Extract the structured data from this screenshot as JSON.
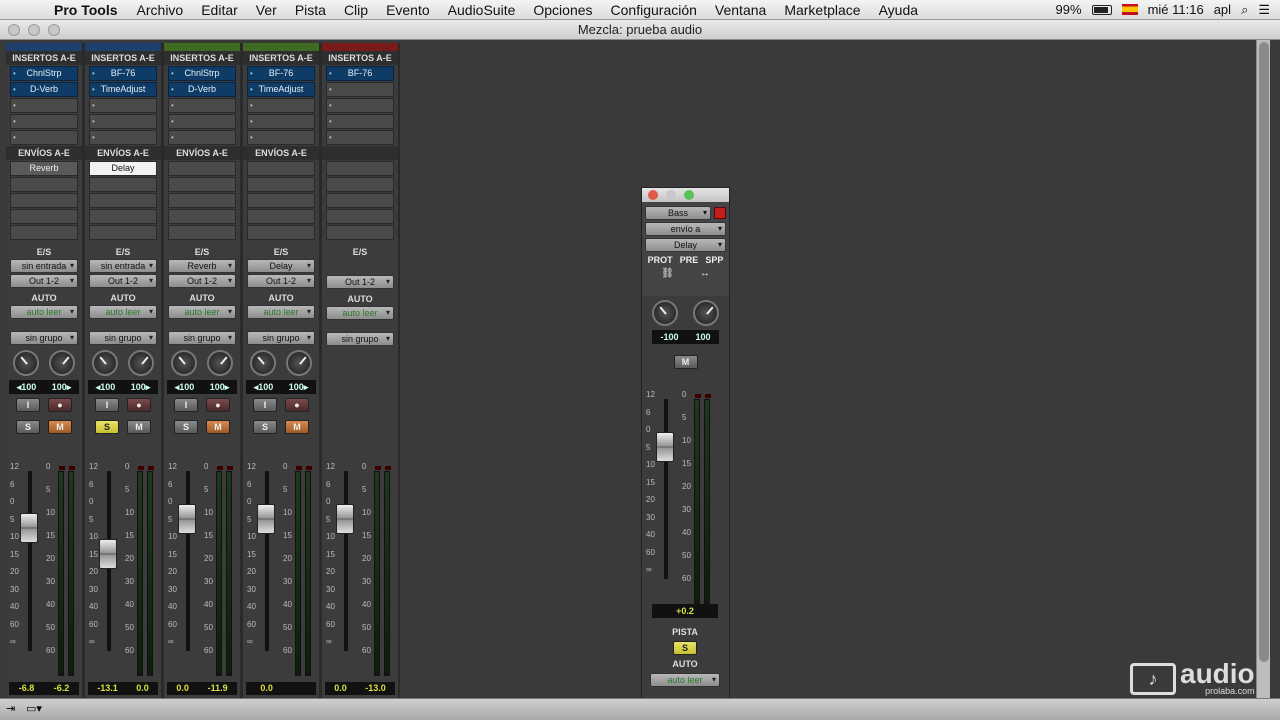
{
  "menubar": {
    "app": "Pro Tools",
    "items": [
      "Archivo",
      "Editar",
      "Ver",
      "Pista",
      "Clip",
      "Evento",
      "AudioSuite",
      "Opciones",
      "Configuración",
      "Ventana",
      "Marketplace",
      "Ayuda"
    ],
    "battery": "99%",
    "clock": "mié 11:16",
    "user": "apl"
  },
  "window": {
    "title": "Mezcla: prueba audio"
  },
  "strips": [
    {
      "color": "#1f3f6e",
      "inserts_label": "INSERTOS A-E",
      "inserts": [
        "ChnlStrp",
        "D-Verb"
      ],
      "sends_label": "ENVÍOS A-E",
      "send": "Reverb",
      "send_on": false,
      "io_label": "E/S",
      "input": "sin entrada",
      "output": "Out 1-2",
      "auto_label": "AUTO",
      "auto": "auto leer",
      "group": "sin grupo",
      "pan_l": "100",
      "pan_r": "100",
      "vol": "-6.8",
      "peak": "-6.2",
      "solo_on": false,
      "mute_on": true,
      "fader_pos": 0.72
    },
    {
      "color": "#1f3f6e",
      "inserts_label": "INSERTOS A-E",
      "inserts": [
        "BF-76",
        "TimeAdjust"
      ],
      "sends_label": "ENVÍOS A-E",
      "send": "Delay",
      "send_on": true,
      "io_label": "E/S",
      "input": "sin entrada",
      "output": "Out 1-2",
      "auto_label": "AUTO",
      "auto": "auto leer",
      "group": "sin grupo",
      "pan_l": "100",
      "pan_r": "100",
      "vol": "-13.1",
      "peak": "0.0",
      "solo_on": true,
      "mute_on": false,
      "fader_pos": 0.55
    },
    {
      "color": "#3f6a22",
      "inserts_label": "INSERTOS A-E",
      "inserts": [
        "ChnlStrp",
        "D-Verb"
      ],
      "sends_label": "ENVÍOS A-E",
      "send": "",
      "send_on": false,
      "io_label": "E/S",
      "input": "Reverb",
      "output": "Out 1-2",
      "auto_label": "AUTO",
      "auto": "auto leer",
      "group": "sin grupo",
      "pan_l": "100",
      "pan_r": "100",
      "vol": "0.0",
      "peak": "-11.9",
      "solo_on": false,
      "mute_on": true,
      "fader_pos": 0.78
    },
    {
      "color": "#3f6a22",
      "inserts_label": "INSERTOS A-E",
      "inserts": [
        "BF-76",
        "TimeAdjust"
      ],
      "sends_label": "ENVÍOS A-E",
      "send": "",
      "send_on": false,
      "io_label": "E/S",
      "input": "Delay",
      "output": "Out 1-2",
      "auto_label": "AUTO",
      "auto": "auto leer",
      "group": "sin grupo",
      "pan_l": "100",
      "pan_r": "100",
      "vol": "0.0",
      "peak": "",
      "solo_on": false,
      "mute_on": true,
      "fader_pos": 0.78
    },
    {
      "color": "#7a1a1a",
      "inserts_label": "INSERTOS A-E",
      "inserts": [
        "BF-76"
      ],
      "sends_label": "",
      "send": "",
      "send_on": false,
      "io_label": "E/S",
      "input": "",
      "output": "Out 1-2",
      "auto_label": "AUTO",
      "auto": "auto leer",
      "group": "sin grupo",
      "pan_l": "",
      "pan_r": "",
      "vol": "0.0",
      "peak": "-13.0",
      "solo_on": false,
      "mute_on": false,
      "fader_pos": 0.78
    }
  ],
  "fader_scale": [
    "12",
    "6",
    "0",
    "5",
    "10",
    "15",
    "20",
    "30",
    "40",
    "60",
    "∞"
  ],
  "meter_scale": [
    "0",
    "5",
    "10",
    "15",
    "20",
    "30",
    "40",
    "50",
    "60"
  ],
  "send_window": {
    "track": "Bass",
    "send_to": "envío a",
    "send": "Delay",
    "modes": [
      "PROT",
      "PRE",
      "SPP"
    ],
    "pan_l": "-100",
    "pan_r": "100",
    "mute": "M",
    "level": "+0.2",
    "track_label": "PISTA",
    "solo": "S",
    "auto_label": "AUTO",
    "auto": "auto leer",
    "fader_pos": 0.78
  },
  "logo": {
    "name": "audio",
    "site": "prolaba.com"
  }
}
